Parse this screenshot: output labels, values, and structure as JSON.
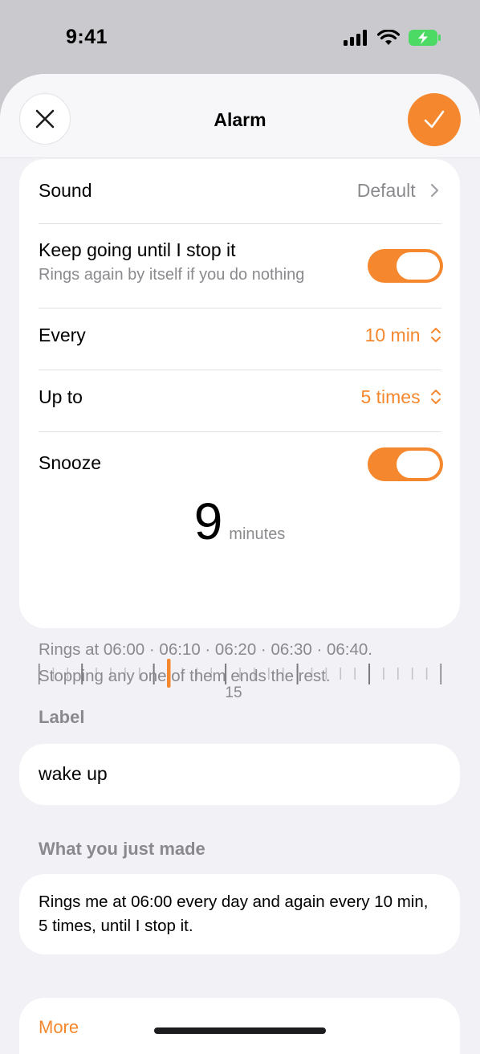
{
  "status": {
    "time": "9:41"
  },
  "header": {
    "title": "Alarm",
    "close_icon": "close-icon",
    "confirm_icon": "checkmark-icon"
  },
  "sound": {
    "label": "Sound",
    "value": "Default"
  },
  "keep_going": {
    "label": "Keep going until I stop it",
    "sublabel": "Rings again by itself if you do nothing",
    "enabled": true
  },
  "every": {
    "label": "Every",
    "value": "10 min"
  },
  "up_to": {
    "label": "Up to",
    "value": "5 times"
  },
  "snooze": {
    "label": "Snooze",
    "enabled": true,
    "value": "9",
    "unit": "minutes",
    "ruler_label": "15"
  },
  "footer": {
    "line1": "Rings at 06:00 · 06:10 · 06:20 · 06:30 · 06:40.",
    "line2": "Stopping any one of them ends the rest."
  },
  "label_section": {
    "title": "Label",
    "value": "wake up"
  },
  "summary_section": {
    "title": "What you just made",
    "text": "Rings me at 06:00 every day and again every 10 min, 5 times, until I stop it."
  },
  "more": {
    "label": "More"
  },
  "colors": {
    "accent": "#f5882e",
    "background": "#f2f1f6",
    "muted": "#8a8a8e"
  }
}
